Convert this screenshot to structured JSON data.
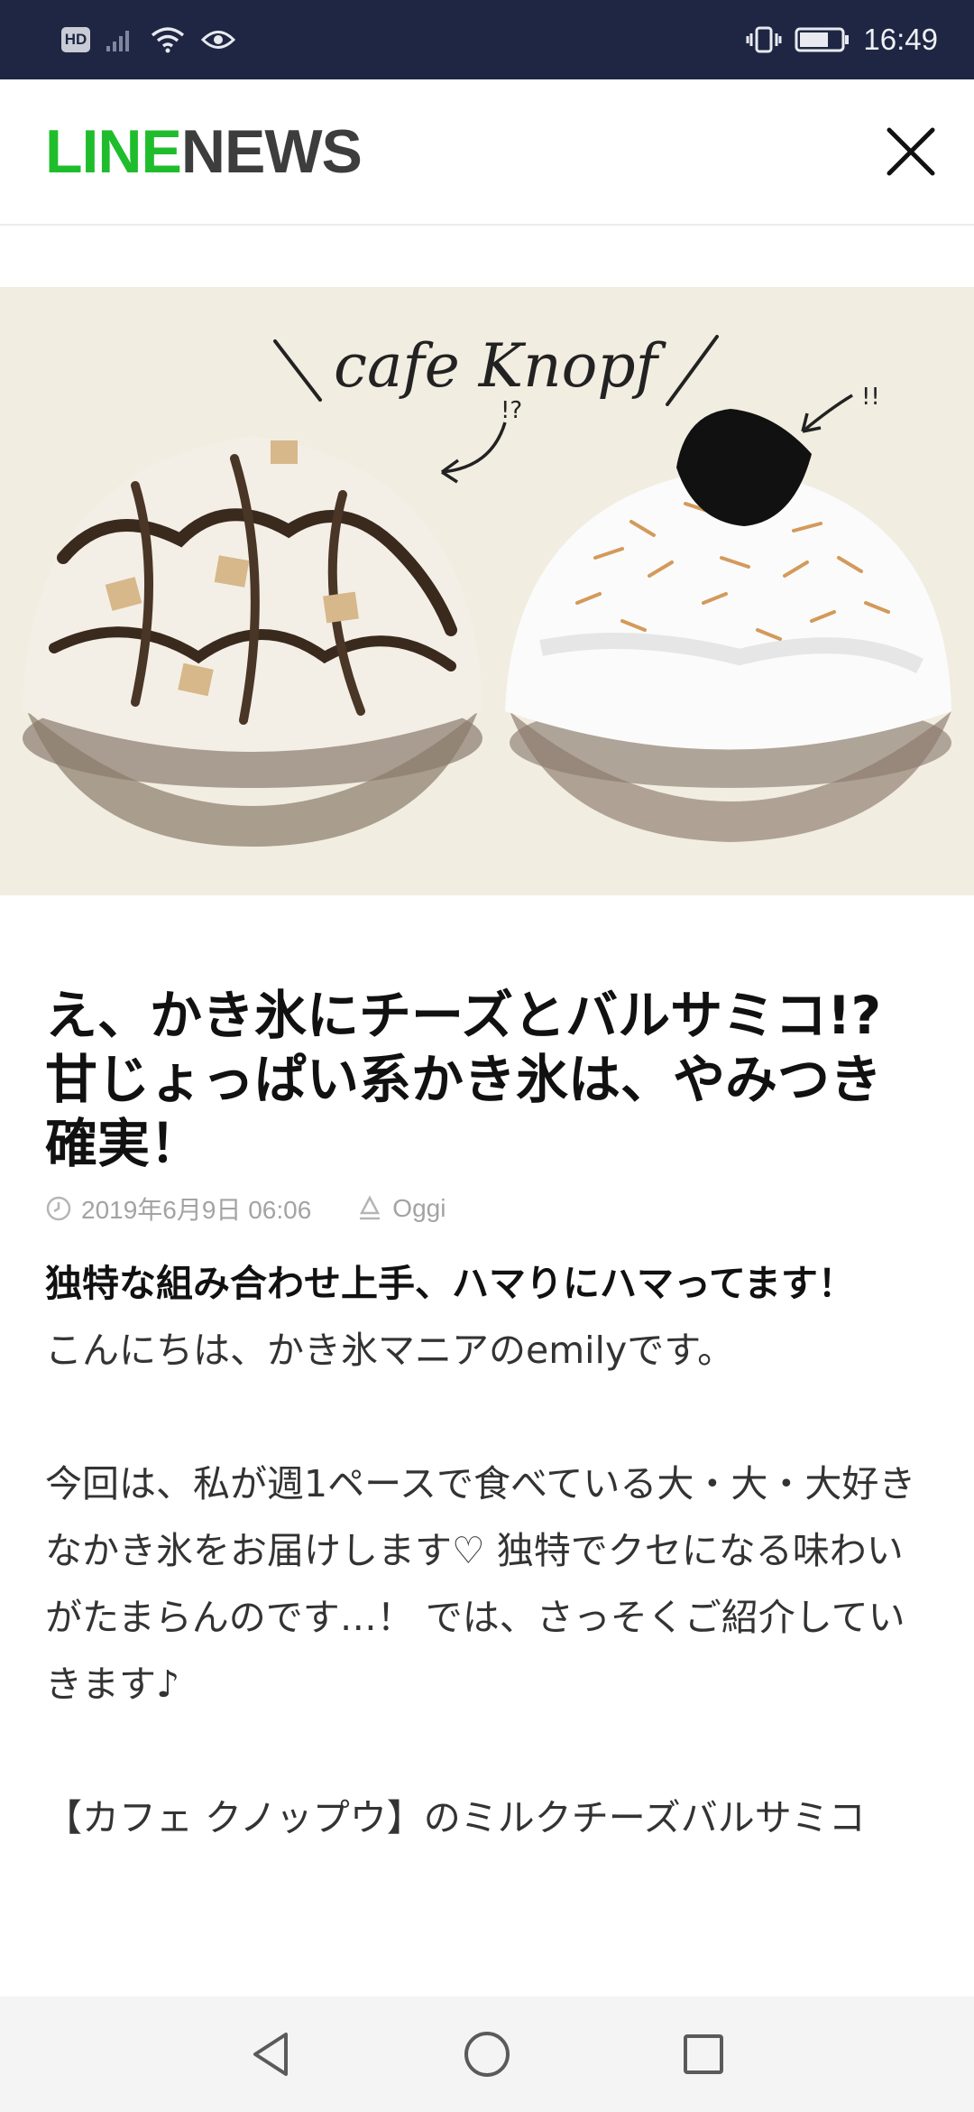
{
  "status_bar": {
    "hd_badge": "HD",
    "time": "16:49",
    "icons": [
      "hd-icon",
      "signal-icon",
      "wifi-icon",
      "eye-icon",
      "vibrate-icon",
      "battery-icon"
    ]
  },
  "header": {
    "logo_line": "LINE",
    "logo_news": "NEWS",
    "close_icon": "close-icon"
  },
  "hero": {
    "handwritten_label": "cafe Knopf",
    "mark_left": "!?",
    "mark_right": "!!"
  },
  "article": {
    "title": "え、かき氷にチーズとバルサミコ!? 甘じょっぱい系かき氷は、やみつき確実！",
    "date": "2019年6月9日 06:06",
    "source": "Oggi",
    "subhead": "独特な組み合わせ上手、ハマりにハマってます！",
    "body": "こんにちは、かき氷マニアのemilyです。\n\n今回は、私が週1ペースで食べている大・大・大好きなかき氷をお届けします♡ 独特でクセになる味わいがたまらんのです…！ では、さっそくご紹介していきます♪\n\n【カフェ クノップウ】のミルクチーズバルサミコ"
  },
  "nav_bar": {
    "icons": [
      "back-icon",
      "home-icon",
      "recents-icon"
    ]
  },
  "colors": {
    "status_bar_bg": "#1e2643",
    "line_green": "#1fbd2c",
    "hero_bg": "#f2ede1"
  }
}
